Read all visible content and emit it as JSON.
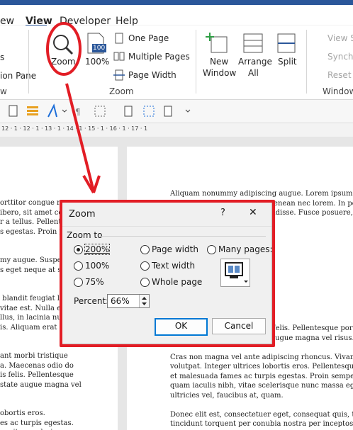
{
  "menu": {
    "tabs": [
      "ew",
      "View",
      "Developer",
      "Help"
    ],
    "active": "View"
  },
  "ribbon": {
    "partial_left": {
      "item1": "s",
      "item2": "ion Pane",
      "group": "w"
    },
    "zoom_group": {
      "zoom_label": "Zoom",
      "hundred_badge": "100",
      "hundred_label": "100%",
      "one_page": "One Page",
      "multiple_pages": "Multiple Pages",
      "page_width": "Page Width",
      "group_label": "Zoom"
    },
    "window_group": {
      "new_window": [
        "New",
        "Window"
      ],
      "arrange_all": [
        "Arrange",
        "All"
      ],
      "split": "Split",
      "view_side": "View S",
      "synch": "Synchr",
      "reset": "Reset W",
      "group_label": "Window"
    }
  },
  "ruler": {
    "text": "12 · 1 · 12 · 1 · 13 · 1 · 14 · 1 · 15 · 1 · 16 · 1 · 17 · 1"
  },
  "document": {
    "left_page": "orttitor congue mass\nibero, sit amet comm\nr a tellus. Pellentesq\ns egestas. Proin pha\n\n\nmy augue. Suspendis\ns eget neque at sem\n\n\n blandit feugiat ligul\nvitae est. Nulla et tellu\nllus, in lacinia nulla n\nis. Aliquam erat\n\n\nant morbi tristique\na. Maecenas odio do\nis felis. Pellentesque\nstate augue magna vel\n\n\nobortis eros.\nes ac turpis egestas.\nn, vitae scelerisque nunc\net, quam. Donec elit est,\n\n\ndonta, per inceptos",
    "right_top": "Aliquam nonummy adipiscing augue. Lorem ipsum dolor sit a\nmalesuada. Mauris et orci. Aenean nec lorem. In porttitor. Do\nmagna. Sed porttitor. Suspendisse. Fusce posuere, magna sed\n",
    "right_bottom": "Pellentesque cursus sagittis felis. Pellentesque porttitor, velit\ntempus arcu, nec vulputate augue magna vel risus.\n\nCras non magna vel ante adipiscing rhoncus. Vivamus a mi. M\nvolutpat. Integer ultrices lobortis eros. Pellentesque habitant m\net malesuada fames ac turpis egestas. Proin semper, ante vitae\nquam iaculis nibh, vitae scelerisque nunc massa eget pede. Sed\nultricies vel, faucibus at, quam.\n\nDonec elit est, consectetuer eget, consequat quis, tempus quis\ntincidunt torquent per conubia nostra per inceptos"
  },
  "dialog": {
    "title": "Zoom",
    "help": "?",
    "close": "✕",
    "section": "Zoom to",
    "options": {
      "p200": "200%",
      "p100": "100%",
      "p75": "75%",
      "page_width": "Page width",
      "text_width": "Text width",
      "whole_page": "Whole page",
      "many_pages": "Many pages:"
    },
    "selected": "p200",
    "percent_label": "Percent:",
    "percent_value": "66%",
    "ok": "OK",
    "cancel": "Cancel"
  },
  "colors": {
    "accent": "#2b579a",
    "annotation": "#e21d25",
    "ok_border": "#0078d4"
  }
}
